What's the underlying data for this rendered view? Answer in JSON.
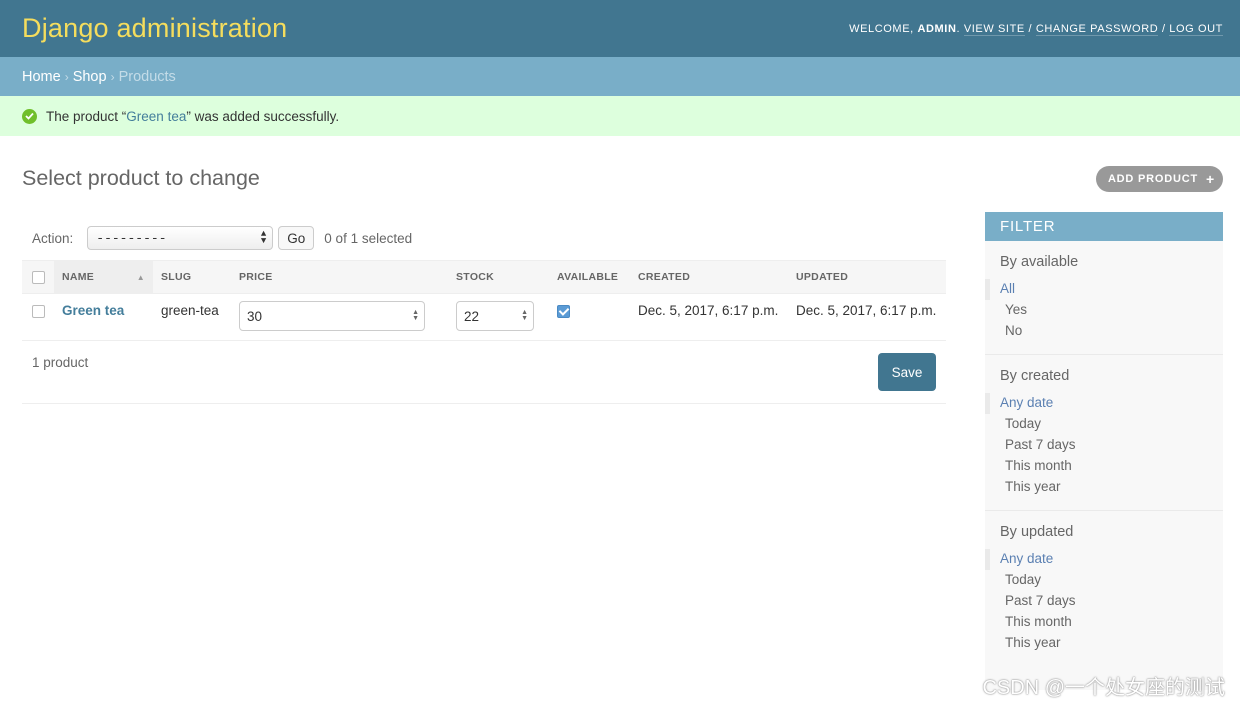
{
  "header": {
    "branding": "Django administration",
    "welcome": "Welcome,",
    "username": "admin",
    "view_site": "View site",
    "change_password": "Change password",
    "log_out": "Log out",
    "sep": "/"
  },
  "breadcrumbs": {
    "home": "Home",
    "shop": "Shop",
    "current": "Products",
    "sep": "›"
  },
  "message": {
    "prefix": "The product “",
    "link": "Green tea",
    "suffix": "” was added successfully."
  },
  "page": {
    "title": "Select product to change",
    "add_button": "Add product",
    "add_icon": "+"
  },
  "actions": {
    "label": "Action:",
    "selected_value": "---------",
    "go": "Go",
    "selected_count": "0 of 1 selected"
  },
  "table": {
    "columns": [
      "Name",
      "Slug",
      "Price",
      "Stock",
      "Available",
      "Created",
      "Updated"
    ],
    "rows": [
      {
        "name": "Green tea",
        "slug": "green-tea",
        "price": "30",
        "stock": "22",
        "available": true,
        "created": "Dec. 5, 2017, 6:17 p.m.",
        "updated": "Dec. 5, 2017, 6:17 p.m."
      }
    ]
  },
  "paginator": {
    "count": "1 product",
    "save": "Save"
  },
  "filter": {
    "title": "Filter",
    "groups": [
      {
        "title": "By available",
        "items": [
          "All",
          "Yes",
          "No"
        ],
        "selected": 0
      },
      {
        "title": "By created",
        "items": [
          "Any date",
          "Today",
          "Past 7 days",
          "This month",
          "This year"
        ],
        "selected": 0
      },
      {
        "title": "By updated",
        "items": [
          "Any date",
          "Today",
          "Past 7 days",
          "This month",
          "This year"
        ],
        "selected": 0
      }
    ]
  },
  "watermark": "CSDN @一个处女座的测试",
  "colors": {
    "header_bg": "#417690",
    "branding": "#f5dd5d",
    "breadcrumbs_bg": "#79aec8",
    "success_bg": "#ddffdd",
    "link": "#447e9b"
  }
}
